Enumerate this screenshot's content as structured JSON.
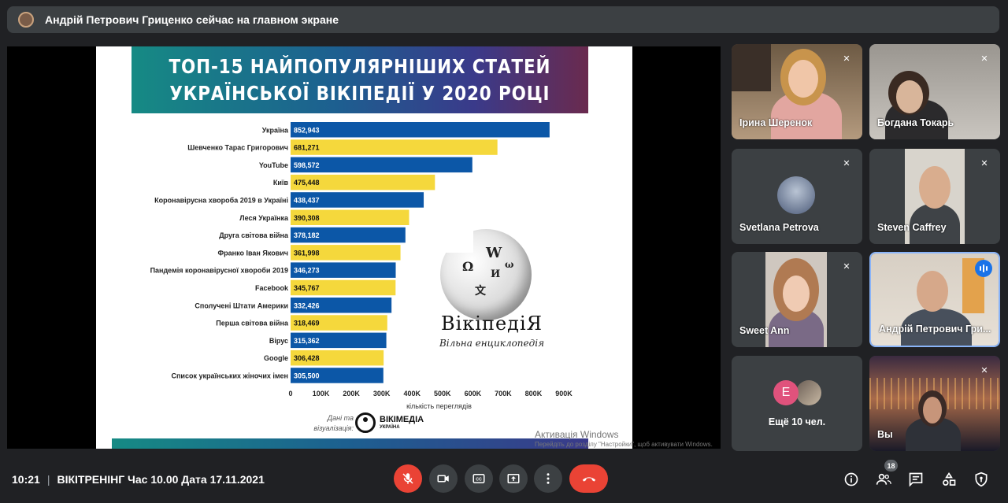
{
  "presenting_banner": "Андрій Петрович Гриценко сейчас на главном экране",
  "slide": {
    "title_line1": "ТОП-15 НАЙПОПУЛЯРНІШИХ СТАТЕЙ",
    "title_line2": "УКРАЇНСЬКОЇ ВІКІПЕДІЇ У 2020 РОЦІ",
    "wiki_logo_name": "ВікіпедіЯ",
    "wiki_logo_sub": "Вільна енциклопедія",
    "credit_label": "Дані та візуалізація:",
    "credit_org": "ВІКІМЕДІА",
    "credit_org_sub": "УКРАЇНА",
    "watermark_line1": "Активація Windows",
    "watermark_line2": "Перейдіть до розділу \"Настройки\", щоб активувати Windows."
  },
  "chart_data": {
    "type": "bar",
    "orientation": "horizontal",
    "title": "ТОП-15 НАЙПОПУЛЯРНІШИХ СТАТЕЙ УКРАЇНСЬКОЇ ВІКІПЕДІЇ У 2020 РОЦІ",
    "xlabel": "кількість переглядів",
    "ylabel": "",
    "xlim": [
      0,
      900000
    ],
    "xticks": [
      "0",
      "100K",
      "200K",
      "300K",
      "400K",
      "500K",
      "600K",
      "700K",
      "800K",
      "900K"
    ],
    "grid": false,
    "categories": [
      "Україна",
      "Шевченко Тарас Григорович",
      "YouTube",
      "Київ",
      "Коронавірусна хвороба 2019 в Україні",
      "Леся Українка",
      "Друга світова війна",
      "Франко Іван Якович",
      "Пандемія коронавірусної хвороби 2019",
      "Facebook",
      "Сполучені Штати Америки",
      "Перша світова війна",
      "Вірус",
      "Google",
      "Список українських жіночих імен"
    ],
    "values": [
      852943,
      681271,
      598572,
      475448,
      438437,
      390308,
      378182,
      361998,
      346273,
      345767,
      332426,
      318469,
      315362,
      306428,
      305500
    ],
    "value_labels": [
      "852,943",
      "681,271",
      "598,572",
      "475,448",
      "438,437",
      "390,308",
      "378,182",
      "361,998",
      "346,273",
      "345,767",
      "332,426",
      "318,469",
      "315,362",
      "306,428",
      "305,500"
    ],
    "bar_colors": [
      "#0c57a7",
      "#f5d83c"
    ]
  },
  "participants": [
    {
      "name": "Ірина Шеренок",
      "muted": true
    },
    {
      "name": "Богдана Токарь",
      "muted": true
    },
    {
      "name": "Svetlana Petrova",
      "muted": true
    },
    {
      "name": "Steven Caffrey",
      "muted": true
    },
    {
      "name": "Sweet Ann",
      "muted": true
    },
    {
      "name": "Андрій Петрович Гри...",
      "muted": false,
      "speaking": true
    },
    {
      "name": "Ещё 10 чел.",
      "initial": "E"
    },
    {
      "name": "Вы",
      "muted": true
    }
  ],
  "meeting": {
    "time": "10:21",
    "separator": "|",
    "title": "ВІКІТРЕНІНГ Час 10.00 Дата 17.11.2021",
    "participants_count": "18"
  },
  "icons": {
    "mic_off": "mic-off-icon",
    "camera": "camera-icon",
    "captions": "captions-icon",
    "present": "present-icon",
    "more": "more-vert-icon",
    "hangup": "call-end-icon",
    "info": "info-icon",
    "people": "people-icon",
    "chat": "chat-icon",
    "activities": "activities-icon",
    "security": "shield-icon"
  }
}
